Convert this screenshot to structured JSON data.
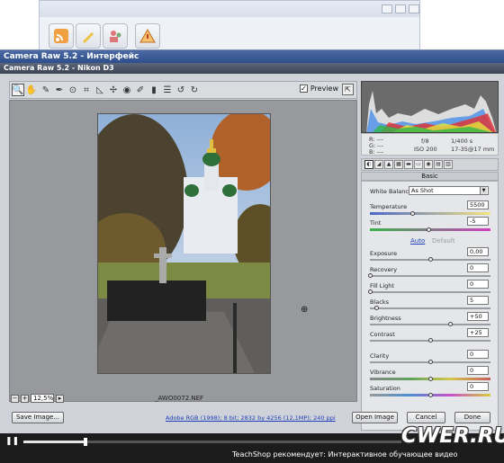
{
  "main_window": {
    "title": "Camera Raw 5.2 - Интерфейс",
    "subtitle": "Camera Raw 5.2  -  Nikon D3"
  },
  "toolbar": {
    "preview_label": "Preview"
  },
  "canvas": {
    "zoom": "12,5%",
    "filename": "_AWO0072.NEF"
  },
  "info": {
    "r_label": "R:",
    "g_label": "G:",
    "b_label": "B:",
    "r_val": "---",
    "g_val": "---",
    "b_val": "---",
    "fstop": "f/8",
    "shutter": "1/400 s",
    "iso": "ISO 200",
    "lens": "17-35@17 mm"
  },
  "panel": {
    "title": "Basic",
    "white_balance_label": "White Balance:",
    "white_balance_value": "As Shot",
    "auto": "Auto",
    "default": "Default",
    "controls": [
      {
        "label": "Temperature",
        "value": "5500"
      },
      {
        "label": "Tint",
        "value": "-5"
      },
      {
        "label": "Exposure",
        "value": "0,00"
      },
      {
        "label": "Recovery",
        "value": "0"
      },
      {
        "label": "Fill Light",
        "value": "0"
      },
      {
        "label": "Blacks",
        "value": "5"
      },
      {
        "label": "Brightness",
        "value": "+50"
      },
      {
        "label": "Contrast",
        "value": "+25"
      },
      {
        "label": "Clarity",
        "value": "0"
      },
      {
        "label": "Vibrance",
        "value": "0"
      },
      {
        "label": "Saturation",
        "value": "0"
      }
    ]
  },
  "footer": {
    "save_image": "Save Image...",
    "info_link": "Adobe RGB (1998); 8 bit; 2832 by 4256 (12,1MP); 240 ppi",
    "open_image": "Open Image",
    "cancel": "Cancel",
    "done": "Done"
  },
  "media": {
    "ticker": "TeachShop рекомендует: Интерактивное обучающее видео",
    "watermark": "CWER.RU"
  }
}
